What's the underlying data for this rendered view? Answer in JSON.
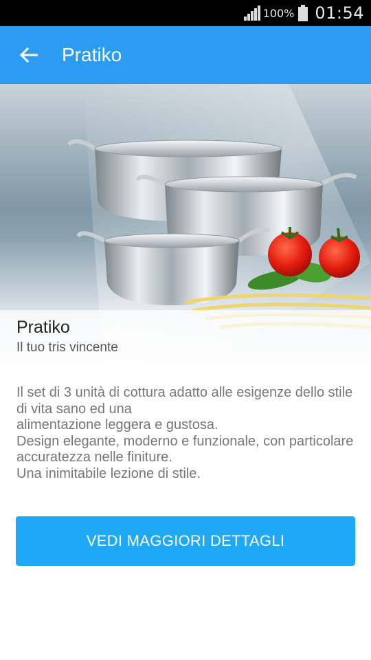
{
  "status_bar": {
    "battery_percent": "100%",
    "time": "01:54",
    "icons": [
      "signal-icon",
      "battery-icon"
    ]
  },
  "app_bar": {
    "title": "Pratiko",
    "back_icon": "arrow-back-icon",
    "color": "#2b9cf2"
  },
  "hero": {
    "image": "stainless-steel-pot-set-with-tomatoes-basil-pasta",
    "title": "Pratiko",
    "subtitle": "Il tuo tris vincente"
  },
  "description": {
    "lines": [
      "Il set di 3 unità di cottura adatto alle esigenze dello stile di vita sano ed una",
      "alimentazione leggera e gustosa.",
      "Design elegante, moderno e funzionale, con particolare accuratezza nelle finiture.",
      "Una inimitabile lezione di stile."
    ]
  },
  "cta": {
    "label": "VEDI MAGGIORI DETTAGLI",
    "color": "#1fa9f4"
  }
}
